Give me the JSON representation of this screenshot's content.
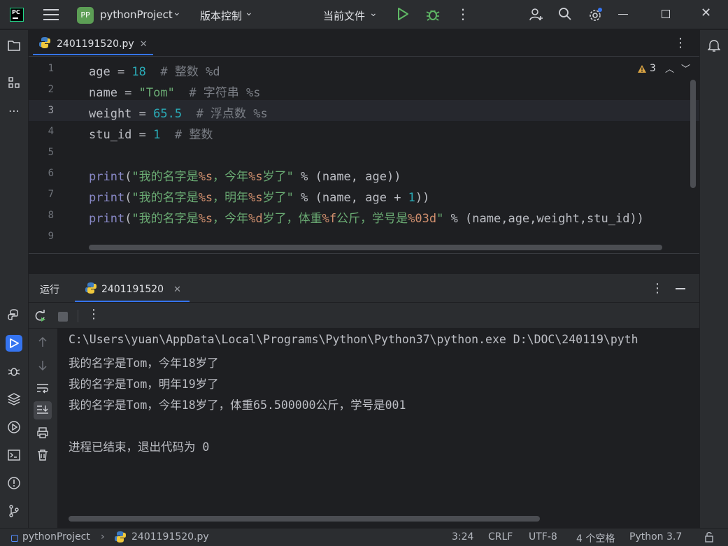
{
  "titlebar": {
    "project_badge": "PP",
    "project_name": "pythonProject",
    "vcs_label": "版本控制",
    "run_config": "当前文件"
  },
  "editor": {
    "tab_label": "2401191520.py",
    "current_line": 3,
    "warnings_count": "3",
    "line_numbers": [
      "1",
      "2",
      "3",
      "4",
      "5",
      "6",
      "7",
      "8",
      "9"
    ]
  },
  "run_panel": {
    "title": "运行",
    "tab_label": "2401191520",
    "output": [
      "C:\\Users\\yuan\\AppData\\Local\\Programs\\Python\\Python37\\python.exe D:\\DOC\\240119\\pyth",
      "我的名字是Tom，今年18岁了",
      "我的名字是Tom，明年19岁了",
      "我的名字是Tom，今年18岁了，体重65.500000公斤，学号是001",
      "",
      "进程已结束，退出代码为 0"
    ]
  },
  "statusbar": {
    "project": "pythonProject",
    "file": "2401191520.py",
    "position": "3:24",
    "line_sep": "CRLF",
    "encoding": "UTF-8",
    "indent": "4 个空格",
    "interpreter": "Python 3.7"
  },
  "colors": {
    "accent": "#3574f0",
    "keyword": "#8888c6",
    "number": "#2aacb8",
    "string": "#6aab73",
    "comment": "#7a7e85",
    "run_green": "#5fb865"
  },
  "icons": [
    "app-logo-icon",
    "hamburger-icon",
    "run-icon",
    "debug-icon",
    "more-icon",
    "add-user-icon",
    "search-icon",
    "settings-icon",
    "minimize-icon",
    "maximize-icon",
    "close-icon",
    "folder-icon",
    "structure-icon",
    "python-console-icon",
    "run-tool-icon",
    "debug-tool-icon",
    "layers-icon",
    "services-icon",
    "terminal-icon",
    "problems-icon",
    "git-icon",
    "notifications-icon",
    "rerun-icon",
    "stop-icon",
    "scroll-up-icon",
    "scroll-down-icon",
    "soft-wrap-icon",
    "scroll-to-end-icon",
    "print-icon",
    "trash-icon",
    "python-file-icon",
    "lock-icon"
  ]
}
